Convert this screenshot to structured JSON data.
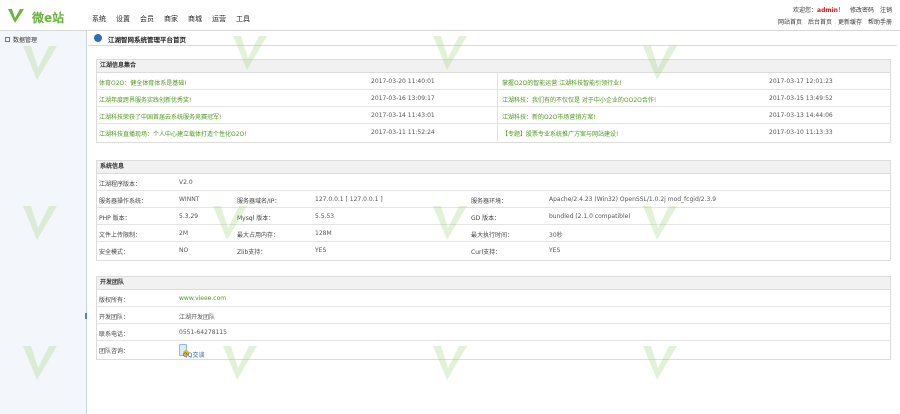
{
  "header": {
    "logo_text": "微e站",
    "nav": [
      "系统",
      "设置",
      "会员",
      "商家",
      "商城",
      "运营",
      "工具"
    ],
    "top_links": {
      "welcome": "欢迎您：",
      "user": "admin",
      "sep": "！",
      "change_pwd": "修改密码",
      "logout": "注销"
    },
    "sub_links": [
      "网站首页",
      "后台首页",
      "更新缓存",
      "帮助手册"
    ]
  },
  "sidebar": {
    "item": "数据管理"
  },
  "page_title": "江湖智网系统管理平台首页",
  "news": {
    "title": "江湖信息集合",
    "left": [
      {
        "text": "体育O2O：健全体育体系是基础!",
        "date": "2017-03-20 11:40:01"
      },
      {
        "text": "江湖年度跨界服务实践创新优秀奖!",
        "date": "2017-03-16 13:09:17"
      },
      {
        "text": "江湖科技荣获了中国首届云系统服务竞赛冠军!",
        "date": "2017-03-14 11:43:01"
      },
      {
        "text": "江湖科技直播现场：个人中心建立载体打造个性化O2O!",
        "date": "2017-03-11 11:52:24"
      }
    ],
    "right": [
      {
        "text": "掌握O2O的智能运营 江湖科技智能引领行业!",
        "date": "2017-03-17 12:01:23"
      },
      {
        "text": "江湖科技：我们有的不仅仅是 对于中小企业的OO2O合作!",
        "date": "2017-03-15 13:49:52"
      },
      {
        "text": "江湖科技：新的O2O市场营销方案!",
        "date": "2017-03-13 14:44:06"
      },
      {
        "text": "【专题】股票专业系统推广方案与网站建设!",
        "date": "2017-03-10 11:13:33"
      }
    ]
  },
  "sysinfo": {
    "title": "系统信息",
    "rows": [
      [
        {
          "k": "江湖程序版本：",
          "v": "V2.0"
        }
      ],
      [
        {
          "k": "服务器操作系统：",
          "v": "WINNT"
        },
        {
          "k": "服务器域名/IP：",
          "v": "127.0.0.1 [ 127.0.0.1 ]"
        },
        {
          "k": "服务器环境：",
          "v": "Apache/2.4.23 (Win32) OpenSSL/1.0.2j mod_fcgid/2.3.9"
        }
      ],
      [
        {
          "k": "PHP 版本：",
          "v": "5.3.29"
        },
        {
          "k": "Mysql 版本：",
          "v": "5.5.53"
        },
        {
          "k": "GD 版本：",
          "v": "bundled (2.1.0 compatible)"
        }
      ],
      [
        {
          "k": "文件上传限制：",
          "v": "2M"
        },
        {
          "k": "最大占用内存：",
          "v": "128M"
        },
        {
          "k": "最大执行时间：",
          "v": "30秒"
        }
      ],
      [
        {
          "k": "安全模式：",
          "v": "NO"
        },
        {
          "k": "Zlib支持：",
          "v": "YES"
        },
        {
          "k": "Curl支持：",
          "v": "YES"
        }
      ]
    ]
  },
  "team": {
    "title": "开发团队",
    "rows": [
      {
        "k": "版权所有：",
        "v": "www.vieee.com"
      },
      {
        "k": "开发团队：",
        "v": "江湖开发团队"
      },
      {
        "k": "联系电话：",
        "v": "0551-64278115"
      },
      {
        "k": "团队咨询：",
        "v": "QQ交谈"
      }
    ]
  },
  "watermark": {
    "text": "微 e 站",
    "site": "www.vieee.com"
  },
  "colors": {
    "accent": "#4f9a1c",
    "logo": "#6cb33f",
    "admin": "#d31c1c",
    "title_dot": "#2f6db5"
  }
}
